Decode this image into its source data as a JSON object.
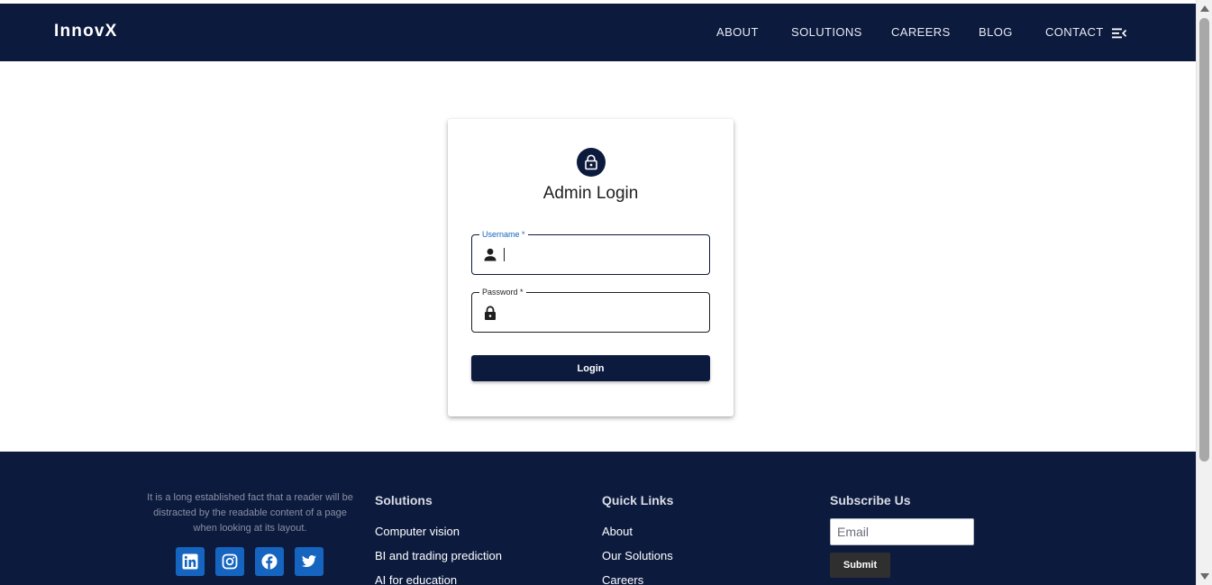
{
  "navbar": {
    "brand": "InnovX",
    "items": [
      {
        "label": "ABOUT"
      },
      {
        "label": "SOLUTIONS"
      },
      {
        "label": "CAREERS"
      },
      {
        "label": "BLOG"
      },
      {
        "label": "CONTACT"
      }
    ],
    "menu_icon": "menu-collapse-icon"
  },
  "login_card": {
    "icon": "lock-icon",
    "title": "Admin Login",
    "username": {
      "label": "Username *",
      "value": "",
      "icon": "person-icon"
    },
    "password": {
      "label": "Password *",
      "value": "",
      "icon": "lock-icon"
    },
    "button_label": "Login"
  },
  "footer": {
    "about_text": "It is a long established fact that a reader will be distracted by the readable content of a page when looking at its layout.",
    "social_icons": [
      "linkedin-icon",
      "instagram-icon",
      "facebook-icon",
      "twitter-icon"
    ],
    "solutions": {
      "title": "Solutions",
      "links": [
        "Computer vision",
        "BI and trading prediction",
        "AI for education"
      ]
    },
    "quick_links": {
      "title": "Quick Links",
      "links": [
        "About",
        "Our Solutions",
        "Careers"
      ]
    },
    "subscribe": {
      "title": "Subscribe Us",
      "email_placeholder": "Email",
      "button_label": "Submit"
    }
  },
  "colors": {
    "navy": "#0c1a3e",
    "accent_blue": "#1565c0",
    "submit_gray": "#2f2f2f"
  }
}
